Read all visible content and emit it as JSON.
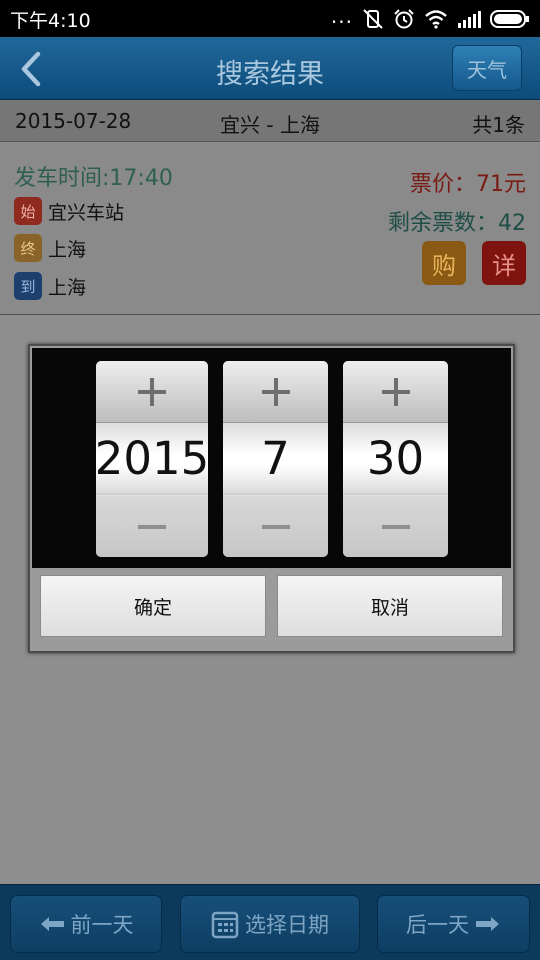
{
  "status_bar": {
    "time": "下午4:10",
    "overflow": "..."
  },
  "title_bar": {
    "title": "搜索结果",
    "weather_label": "天气"
  },
  "results_header": {
    "date": "2015-07-28",
    "route": "宜兴 - 上海",
    "count": "共1条"
  },
  "ticket": {
    "depart_time": "发车时间:17:40",
    "price": "票价：71元",
    "remaining": "剩余票数：42",
    "stops": [
      {
        "tag": "始",
        "name": "宜兴车站"
      },
      {
        "tag": "终",
        "name": "上海"
      },
      {
        "tag": "到",
        "name": "上海"
      }
    ],
    "buy_label": "购",
    "detail_label": "详"
  },
  "date_picker": {
    "year": "2015",
    "month": "7",
    "day": "30",
    "confirm_label": "确定",
    "cancel_label": "取消"
  },
  "bottom_bar": {
    "prev_day": "前一天",
    "pick_date": "选择日期",
    "next_day": "后一天"
  },
  "colors": {
    "title_bar": "#0c4c7b",
    "price": "#7a1a14",
    "remain": "#1f4e46",
    "buy": "#8a5a14",
    "detail": "#7e1310"
  }
}
